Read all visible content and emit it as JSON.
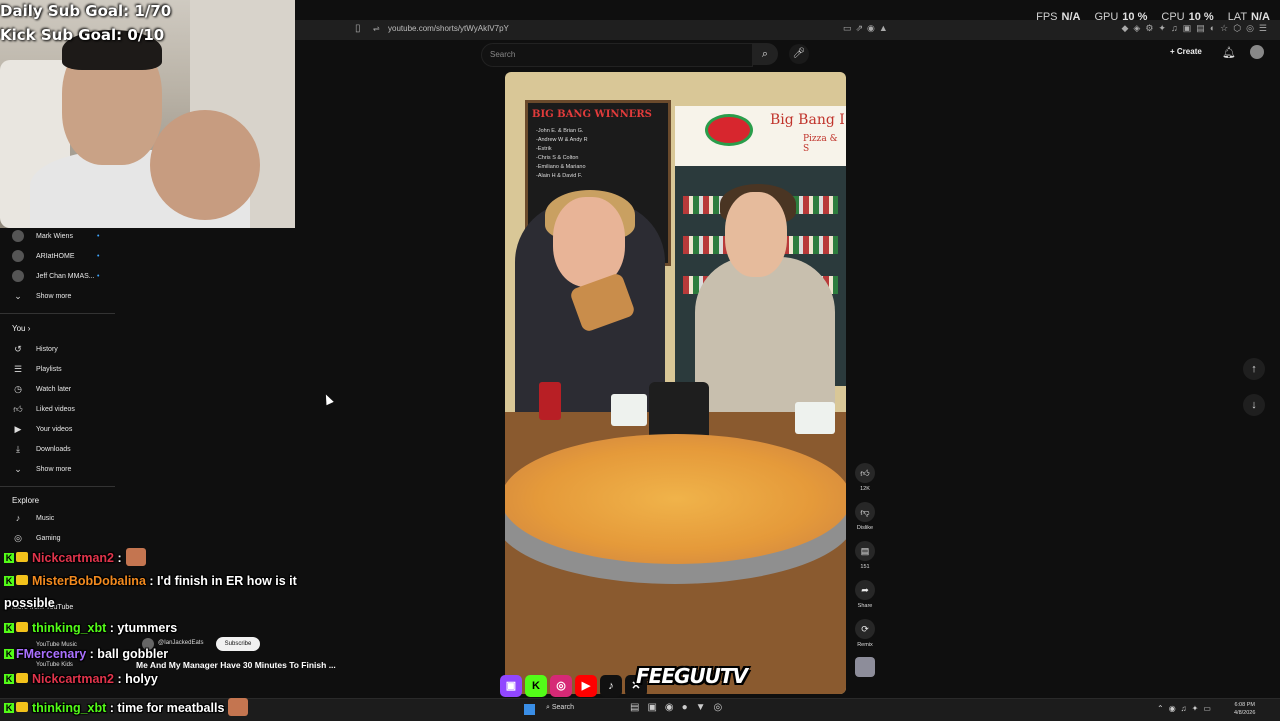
{
  "stream_overlay": {
    "daily_sub_goal": "Daily Sub Goal: 1/70",
    "kick_sub_goal": "Kick Sub Goal: 0/10",
    "stats": [
      {
        "label": "FPS",
        "value": "N/A"
      },
      {
        "label": "GPU",
        "value": "10 %"
      },
      {
        "label": "CPU",
        "value": "10 %"
      },
      {
        "label": "LAT",
        "value": "N/A"
      }
    ]
  },
  "browser": {
    "url": "youtube.com/shorts/ytWyAkIV7pY"
  },
  "header": {
    "search_placeholder": "Search",
    "create_label": "Create"
  },
  "sidebar": {
    "subscriptions": [
      {
        "label": "Mark Wiens"
      },
      {
        "label": "ARIatHOME"
      },
      {
        "label": "Jeff Chan MMAS..."
      }
    ],
    "show_more_1": "Show more",
    "you_heading": "You",
    "you_items": [
      {
        "label": "History",
        "icon": "history-icon"
      },
      {
        "label": "Playlists",
        "icon": "playlists-icon"
      },
      {
        "label": "Watch later",
        "icon": "watch-later-icon"
      },
      {
        "label": "Liked videos",
        "icon": "liked-icon"
      },
      {
        "label": "Your videos",
        "icon": "your-videos-icon"
      },
      {
        "label": "Downloads",
        "icon": "downloads-icon"
      }
    ],
    "show_more_2": "Show more",
    "explore_heading": "Explore",
    "explore_items": [
      {
        "label": "Music",
        "icon": "music-icon"
      },
      {
        "label": "Gaming",
        "icon": "gaming-icon"
      }
    ],
    "more_from_youtube": "More from YouTube",
    "youtube_music": "YouTube Music",
    "youtube_kids": "YouTube Kids"
  },
  "video": {
    "board_title": "BIG BANG WINNERS",
    "board_lines": "-John E. & Brian G.\n-Andrew W & Andy R\n-Estrik\n-Chris S & Colton\n-Emiliano & Mariano\n-Alain H & David F.",
    "sign_title": "Big Bang I",
    "sign_subtitle": "Pizza & S",
    "channel": "@IanJackedEats",
    "subscribe_label": "Subscribe",
    "title": "Me And My Manager Have 30 Minutes To Finish ..."
  },
  "actions": {
    "like_count": "12K",
    "dislike_label": "Dislike",
    "comments_count": "151",
    "share_label": "Share",
    "remix_label": "Remix"
  },
  "chat": [
    {
      "user": "Nickcartman2",
      "message": ":",
      "user_color": "#e0344b",
      "emote": true
    },
    {
      "user": "MisterBobDobalina",
      "message": ": I'd finish in ER how is it",
      "user_color": "#f28a1f"
    },
    {
      "user": "",
      "message": "possible",
      "user_color": "#ffffff"
    },
    {
      "user": "thinking_xbt",
      "message": ": ytummers",
      "user_color": "#53fc18"
    },
    {
      "user": "FMercenary",
      "message": ": ball gobbler",
      "user_color": "#a970ff"
    },
    {
      "user": "Nickcartman2",
      "message": ": holyy",
      "user_color": "#e0344b"
    },
    {
      "user": "thinking_xbt",
      "message": ": time for meatballs",
      "user_color": "#53fc18",
      "emote": true
    }
  ],
  "brand": "FEEGUUTV",
  "taskbar": {
    "search_label": "Search",
    "time": "6:08 PM",
    "date": "4/8/2026"
  },
  "colors": {
    "background": "#0f0f0f",
    "kick_green": "#53fc18",
    "youtube_red": "#ff0000"
  }
}
